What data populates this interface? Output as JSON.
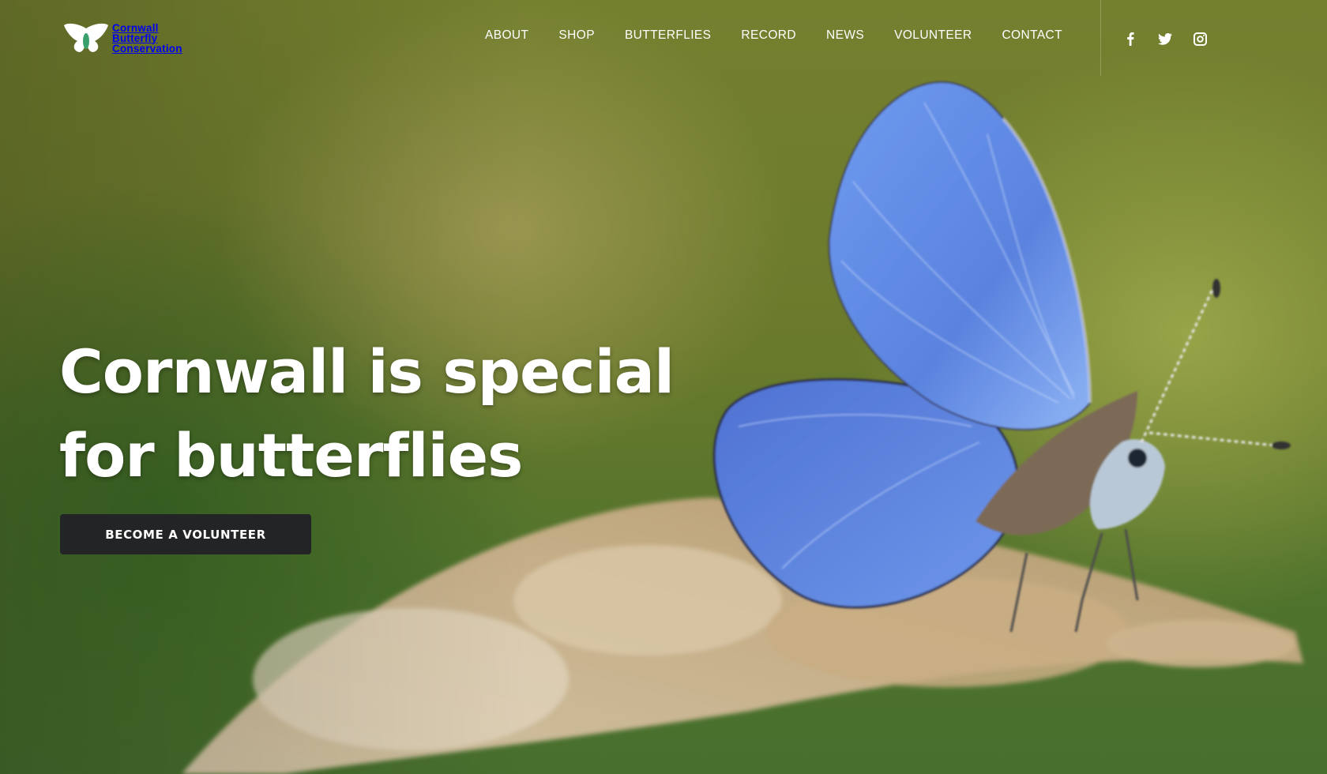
{
  "brand": {
    "logo_lines": [
      "Cornwall",
      "Butterfly",
      "Conservation"
    ],
    "logo_icon": "butterfly-icon"
  },
  "nav": {
    "items": [
      {
        "label": "ABOUT"
      },
      {
        "label": "SHOP"
      },
      {
        "label": "BUTTERFLIES"
      },
      {
        "label": "RECORD"
      },
      {
        "label": "NEWS"
      },
      {
        "label": "VOLUNTEER"
      },
      {
        "label": "CONTACT"
      }
    ]
  },
  "social": {
    "icons": [
      "facebook-icon",
      "twitter-icon",
      "instagram-icon"
    ]
  },
  "hero": {
    "headline_line1": "Cornwall is special",
    "headline_line2": "for butterflies",
    "cta_label": "BECOME A VOLUNTEER",
    "image": "blue-butterfly-on-grass-seed-head"
  },
  "colors": {
    "butterfly_blue": "#5b84e0",
    "background_green": "#6a7a2c",
    "cta_background": "#222425",
    "text": "#ffffff"
  }
}
